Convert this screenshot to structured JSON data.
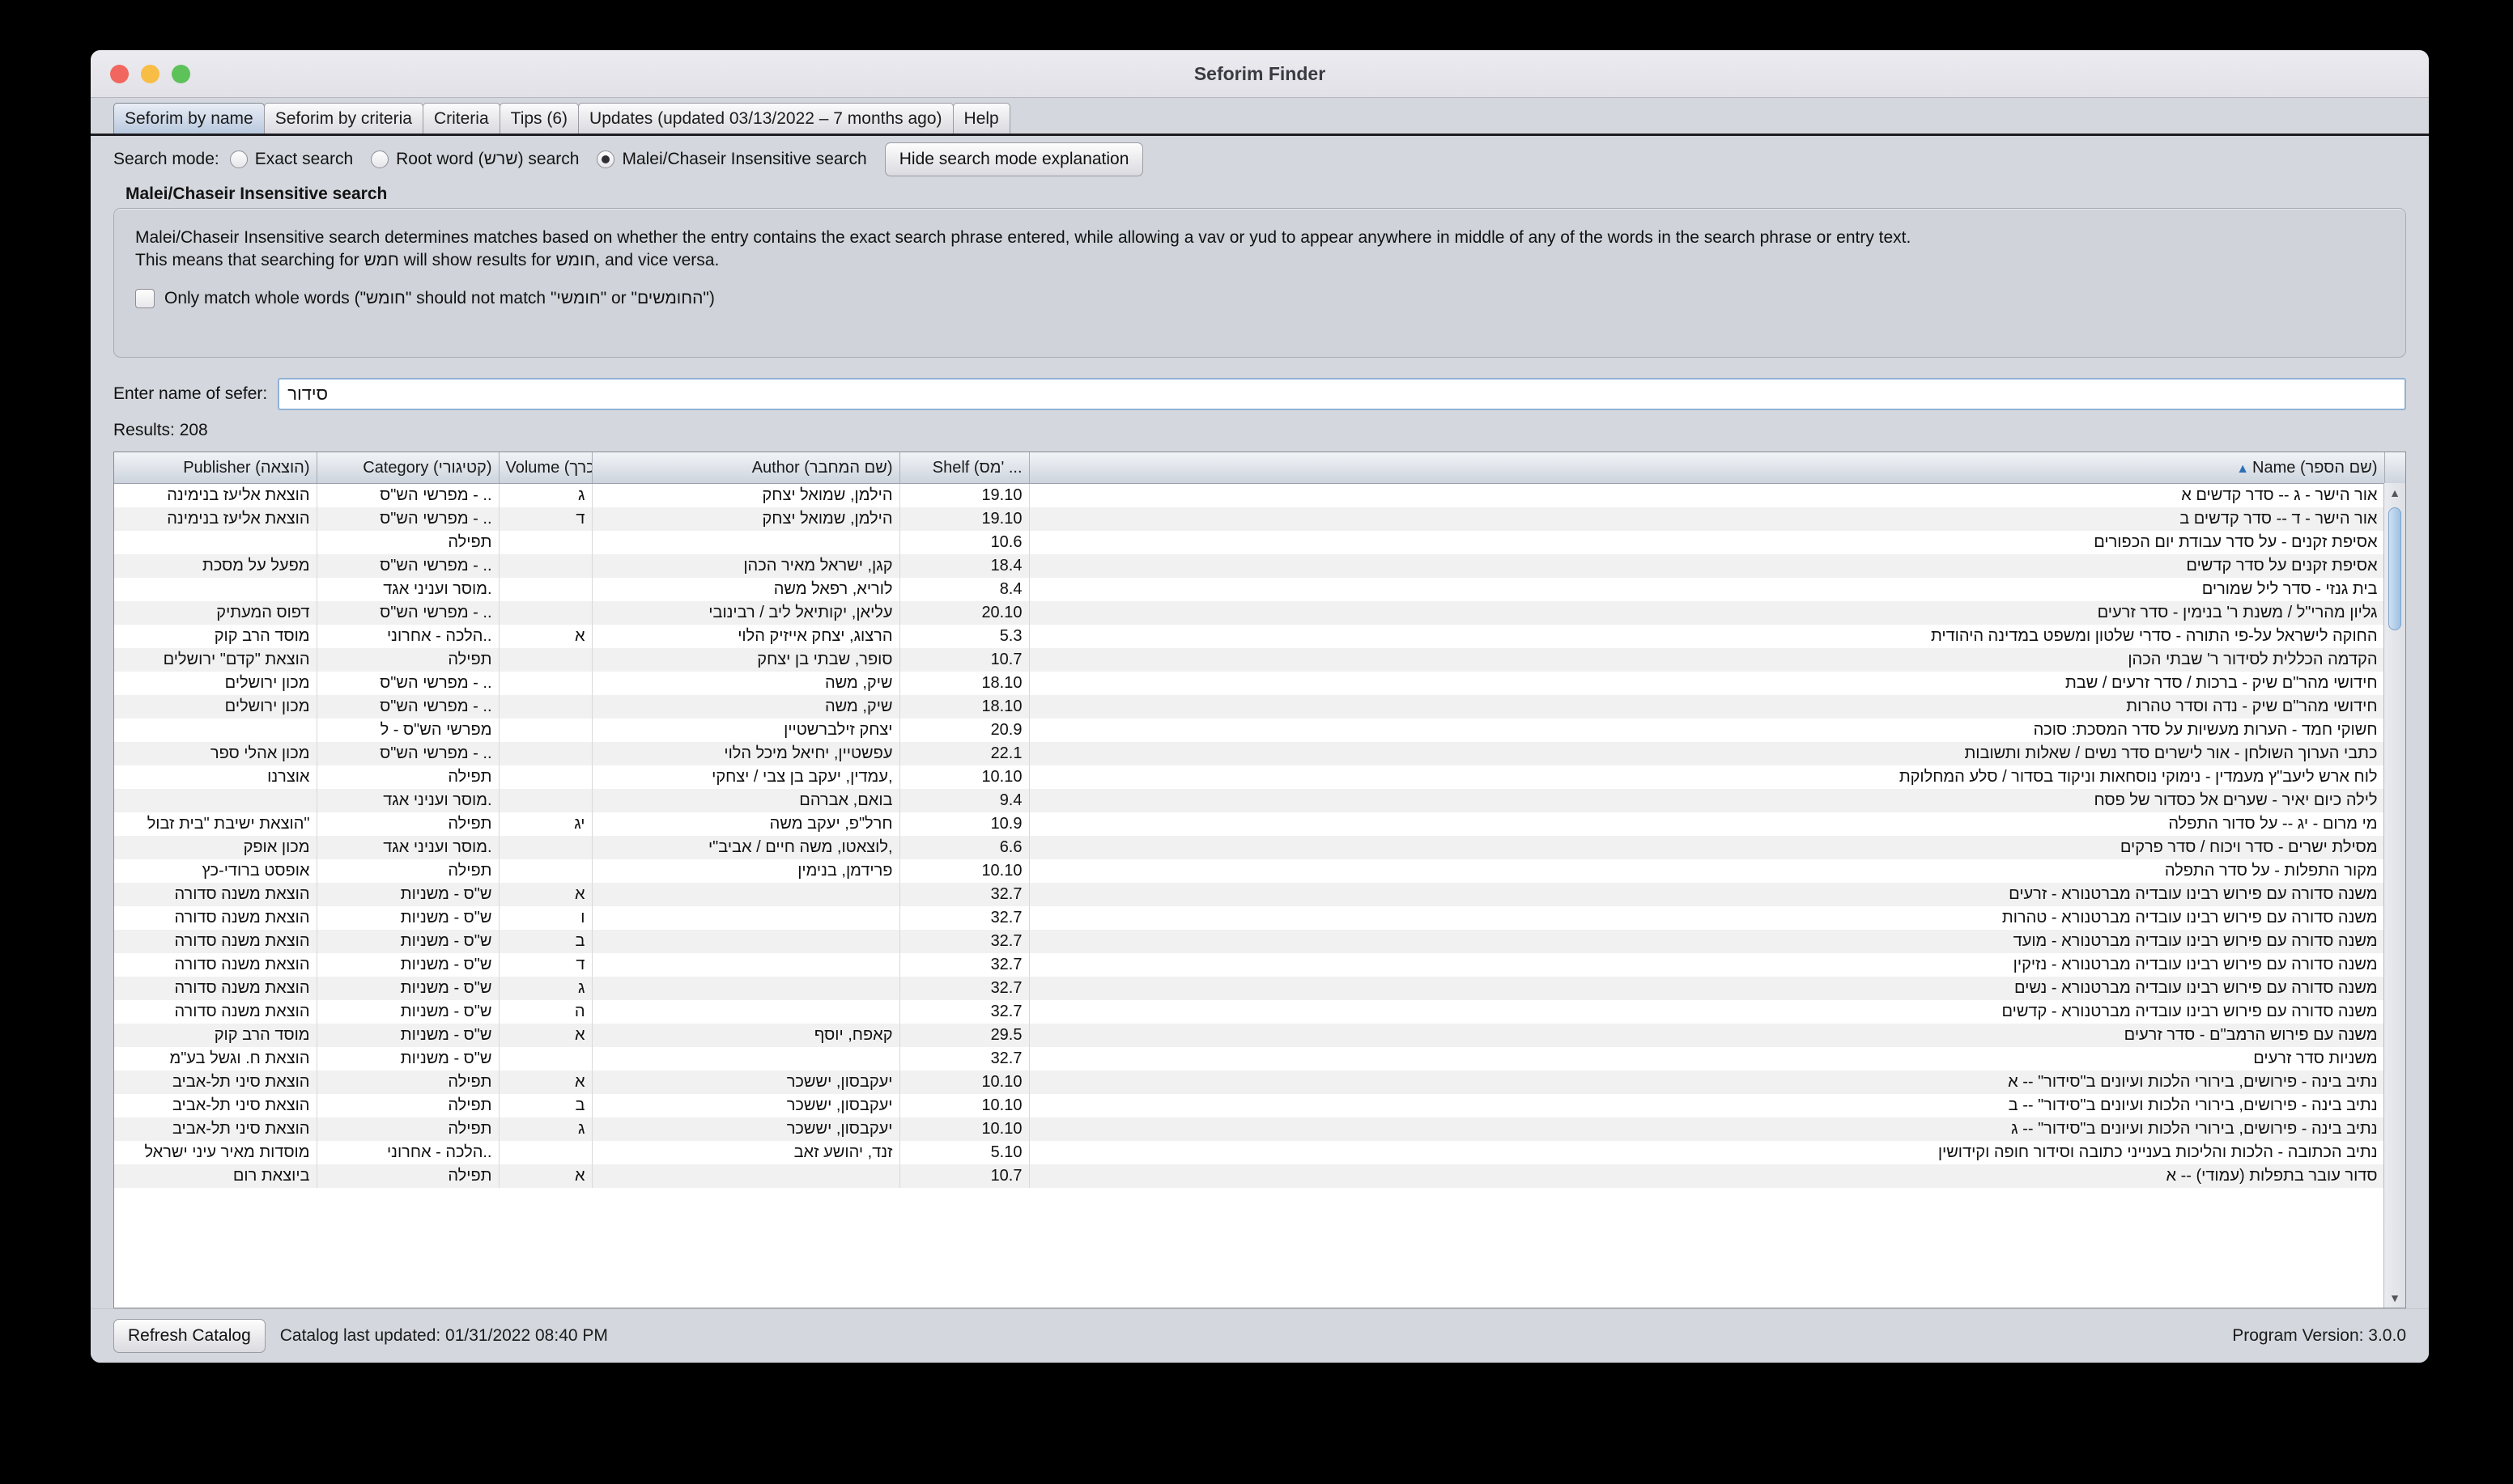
{
  "window": {
    "title": "Seforim Finder",
    "traffic_lights": [
      "close",
      "minimize",
      "zoom"
    ]
  },
  "tabs": [
    {
      "label": "Seforim by name",
      "active": true
    },
    {
      "label": "Seforim by criteria",
      "active": false
    },
    {
      "label": "Criteria",
      "active": false
    },
    {
      "label": "Tips (6)",
      "active": false
    },
    {
      "label": "Updates (updated 03/13/2022 – 7 months ago)",
      "active": false
    },
    {
      "label": "Help",
      "active": false
    }
  ],
  "search_mode": {
    "label": "Search mode:",
    "options": [
      {
        "label": "Exact search",
        "selected": false
      },
      {
        "label": "Root word (שרש) search",
        "selected": false
      },
      {
        "label": "Malei/Chaseir Insensitive search",
        "selected": true
      }
    ],
    "toggle_button": "Hide search mode explanation"
  },
  "explanation": {
    "title": "Malei/Chaseir Insensitive search",
    "line1": "Malei/Chaseir Insensitive search determines matches based on whether the entry contains the exact search phrase entered, while allowing a vav or yud to appear anywhere in middle of any of the words in the search phrase or entry text.",
    "line2": "This means that searching for חמש will show results for חומש, and vice versa.",
    "checkbox_label": "Only match whole words (\"חומש\" should not match \"חומשי\" or \"החומשים\")",
    "checkbox_checked": false
  },
  "search": {
    "label": "Enter name of sefer:",
    "value": "סידור",
    "placeholder": ""
  },
  "results_label": "Results: 208",
  "table": {
    "columns": [
      {
        "key": "publisher",
        "label": "Publisher (הוצאה)"
      },
      {
        "key": "category",
        "label": "Category (קטיגורי)"
      },
      {
        "key": "volume",
        "label": "Volume (כרך)"
      },
      {
        "key": "author",
        "label": "Author (שם המחבר)"
      },
      {
        "key": "shelf",
        "label": "Shelf (מס' ..."
      },
      {
        "key": "name",
        "label": "Name (שם הספר)",
        "sorted": "asc",
        "sort_arrow": "▲"
      }
    ],
    "rows": [
      {
        "publisher": "הוצאת אליעז בנימינה",
        "category": "מפרשי הש\"ס - ..",
        "volume": "ג",
        "author": "הילמן, שמואל יצחק",
        "shelf": "19.10",
        "name": "אור הישר - ג -- סדר קדשים א"
      },
      {
        "publisher": "הוצאת אליעז בנימינה",
        "category": "מפרשי הש\"ס - ..",
        "volume": "ד",
        "author": "הילמן, שמואל יצחק",
        "shelf": "19.10",
        "name": "אור הישר - ד -- סדר קדשים ב"
      },
      {
        "publisher": "",
        "category": "תפילה",
        "volume": "",
        "author": "",
        "shelf": "10.6",
        "name": "אסיפת זקנים - על סדר עבודת יום הכפורים"
      },
      {
        "publisher": "מפעל על מסכת",
        "category": "מפרשי הש\"ס - ..",
        "volume": "",
        "author": "קגן, ישראל מאיר הכהן",
        "shelf": "18.4",
        "name": "אסיפת זקנים על סדר קדשים"
      },
      {
        "publisher": "",
        "category": "מוסר ועניני אגד.",
        "volume": "",
        "author": "לוריא, רפאל משה",
        "shelf": "8.4",
        "name": "בית גנזי - סדר ליל שמורים"
      },
      {
        "publisher": "דפוס המעתיק",
        "category": "מפרשי הש\"ס - ..",
        "volume": "",
        "author": "עליאן, יקותיאל ליב / רבינובי",
        "shelf": "20.10",
        "name": "גליון מהרי\"ל / משנת ר' בנימין - סדר זרעים"
      },
      {
        "publisher": "מוסד הרב קוק",
        "category": "הלכה - אחרוני..",
        "volume": "א",
        "author": "הרצוג, יצחק אייזיק הלוי",
        "shelf": "5.3",
        "name": "החוקה לישראל על-פי התורה - סדרי שלטון ומשפט במדינה היהודית"
      },
      {
        "publisher": "הוצאת \"קדם\" ירושלים",
        "category": "תפילה",
        "volume": "",
        "author": "סופר, שבתי בן יצחק",
        "shelf": "10.7",
        "name": "הקדמה הכללית לסידור ר' שבתי הכהן"
      },
      {
        "publisher": "מכון ירושלים",
        "category": "מפרשי הש\"ס - ..",
        "volume": "",
        "author": "שיק, משה",
        "shelf": "18.10",
        "name": "חידושי מהר\"ם שיק - ברכות / סדר זרעים / שבת"
      },
      {
        "publisher": "מכון ירושלים",
        "category": "מפרשי הש\"ס - ..",
        "volume": "",
        "author": "שיק, משה",
        "shelf": "18.10",
        "name": "חידושי מהר\"ם שיק - נדה וסדר טהרות"
      },
      {
        "publisher": "",
        "category": "מפרשי הש\"ס - ל",
        "volume": "",
        "author": "יצחק זילברשטיין",
        "shelf": "20.9",
        "name": "חשוקי חמד - הערות מעשיות על סדר המסכת: סוכה"
      },
      {
        "publisher": "מכון אהלי ספר",
        "category": "מפרשי הש\"ס - ..",
        "volume": "",
        "author": "עפשטיין, יחיאל מיכל הלוי",
        "shelf": "22.1",
        "name": "כתבי הערוך השולחן - אור לישרים סדר נשים / שאלות ותשובות"
      },
      {
        "publisher": "אוצרנו",
        "category": "תפילה",
        "volume": "",
        "author": "עמדין, יעקב בן צבי / יצחקי,",
        "shelf": "10.10",
        "name": "לוח ארש ליעב\"ץ מעמדין - נימוקי נוסחאות וניקוד בסדור / סלע המחלוקת"
      },
      {
        "publisher": "",
        "category": "מוסר ועניני אגד.",
        "volume": "",
        "author": "בואם, אברהם",
        "shelf": "9.4",
        "name": "לילה כיום יאיר - שערים אל כסדור של פסח"
      },
      {
        "publisher": "הוצאת ישיבת \"בית זבול\"",
        "category": "תפילה",
        "volume": "יג",
        "author": "חרל\"פ, יעקב משה",
        "shelf": "10.9",
        "name": "מי מרום - יג -- על סדור התפלה"
      },
      {
        "publisher": "מכון אופק",
        "category": "מוסר ועניני אגד.",
        "volume": "",
        "author": "לוצאטו, משה חיים / אביב\"י,",
        "shelf": "6.6",
        "name": "מסילת ישרים - סדר ויכוח / סדר פרקים"
      },
      {
        "publisher": "אופסט ברודי-כץ",
        "category": "תפילה",
        "volume": "",
        "author": "פרידמן, בנימין",
        "shelf": "10.10",
        "name": "מקור התפלות - על סדר התפלה"
      },
      {
        "publisher": "הוצאת משנה סדורה",
        "category": "ש\"ס - משניות",
        "volume": "א",
        "author": "",
        "shelf": "32.7",
        "name": "משנה סדורה עם פירוש רבינו עובדיה מברטנורא - זרעים"
      },
      {
        "publisher": "הוצאת משנה סדורה",
        "category": "ש\"ס - משניות",
        "volume": "ו",
        "author": "",
        "shelf": "32.7",
        "name": "משנה סדורה עם פירוש רבינו עובדיה מברטנורא - טהרות"
      },
      {
        "publisher": "הוצאת משנה סדורה",
        "category": "ש\"ס - משניות",
        "volume": "ב",
        "author": "",
        "shelf": "32.7",
        "name": "משנה סדורה עם פירוש רבינו עובדיה מברטנורא - מועד"
      },
      {
        "publisher": "הוצאת משנה סדורה",
        "category": "ש\"ס - משניות",
        "volume": "ד",
        "author": "",
        "shelf": "32.7",
        "name": "משנה סדורה עם פירוש רבינו עובדיה מברטנורא - נזיקין"
      },
      {
        "publisher": "הוצאת משנה סדורה",
        "category": "ש\"ס - משניות",
        "volume": "ג",
        "author": "",
        "shelf": "32.7",
        "name": "משנה סדורה עם פירוש רבינו עובדיה מברטנורא - נשים"
      },
      {
        "publisher": "הוצאת משנה סדורה",
        "category": "ש\"ס - משניות",
        "volume": "ה",
        "author": "",
        "shelf": "32.7",
        "name": "משנה סדורה עם פירוש רבינו עובדיה מברטנורא - קדשים"
      },
      {
        "publisher": "מוסד הרב קוק",
        "category": "ש\"ס - משניות",
        "volume": "א",
        "author": "קאפח, יוסף",
        "shelf": "29.5",
        "name": "משנה עם פירוש הרמב\"ם - סדר זרעים"
      },
      {
        "publisher": "הוצאת ח. וגשל בע\"מ",
        "category": "ש\"ס - משניות",
        "volume": "",
        "author": "",
        "shelf": "32.7",
        "name": "משניות סדר זרעים"
      },
      {
        "publisher": "הוצאת סיני תל-אביב",
        "category": "תפילה",
        "volume": "א",
        "author": "יעקבסון, יששכר",
        "shelf": "10.10",
        "name": "נתיב בינה - פירושים, בירורי הלכות ועיונים ב\"סידור\" -- א"
      },
      {
        "publisher": "הוצאת סיני תל-אביב",
        "category": "תפילה",
        "volume": "ב",
        "author": "יעקבסון, יששכר",
        "shelf": "10.10",
        "name": "נתיב בינה - פירושים, בירורי הלכות ועיונים ב\"סידור\" -- ב"
      },
      {
        "publisher": "הוצאת סיני תל-אביב",
        "category": "תפילה",
        "volume": "ג",
        "author": "יעקבסון, יששכר",
        "shelf": "10.10",
        "name": "נתיב בינה - פירושים, בירורי הלכות ועיונים ב\"סידור\" -- ג"
      },
      {
        "publisher": "מוסדות מאיר עיני ישראל",
        "category": "הלכה - אחרוני..",
        "volume": "",
        "author": "זנד, יהושע זאב",
        "shelf": "5.10",
        "name": "נתיב הכתובה - הלכות והליכות בענייני כתובה וסידור חופה וקידושין"
      },
      {
        "publisher": "ביוצאת רום",
        "category": "תפילה",
        "volume": "א",
        "author": "",
        "shelf": "10.7",
        "name": "סדור עובר בתפלות (עמודי) -- א"
      }
    ]
  },
  "statusbar": {
    "refresh_button": "Refresh Catalog",
    "catalog_updated": "Catalog last updated: 01/31/2022 08:40 PM",
    "program_version": "Program Version: 3.0.0"
  },
  "scrollbar": {
    "up_arrow": "▲",
    "down_arrow": "▼"
  }
}
